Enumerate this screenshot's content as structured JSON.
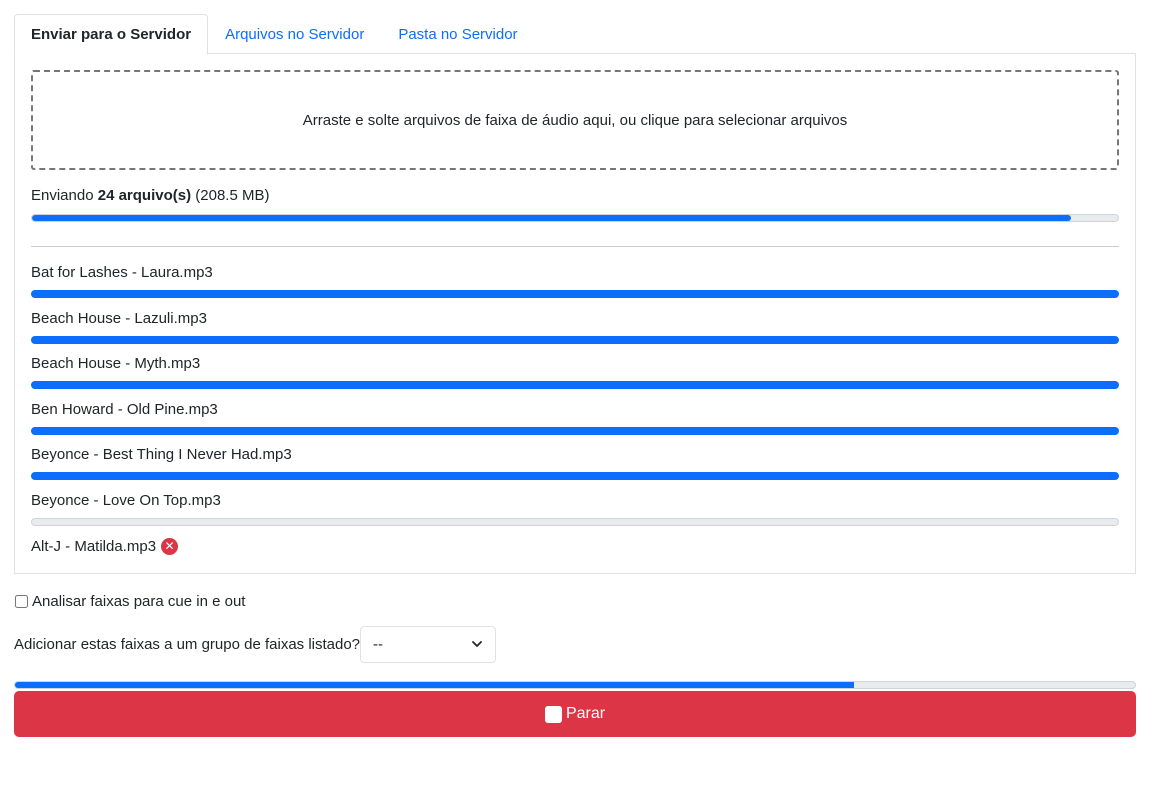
{
  "tabs": [
    {
      "label": "Enviar para o Servidor",
      "active": true
    },
    {
      "label": "Arquivos no Servidor",
      "active": false
    },
    {
      "label": "Pasta no Servidor",
      "active": false
    }
  ],
  "dropzone": {
    "text": "Arraste e solte arquivos de faixa de áudio aqui, ou clique para selecionar arquivos"
  },
  "upload": {
    "prefix": "Enviando",
    "count": "24 arquivo(s)",
    "size": "(208.5 MB)",
    "progress_pct": 95.7
  },
  "files": [
    {
      "name": "Bat for Lashes - Laura.mp3",
      "status": "done",
      "progress_pct": 100
    },
    {
      "name": "Beach House - Lazuli.mp3",
      "status": "done",
      "progress_pct": 100
    },
    {
      "name": "Beach House - Myth.mp3",
      "status": "done",
      "progress_pct": 100
    },
    {
      "name": "Ben Howard - Old Pine.mp3",
      "status": "done",
      "progress_pct": 100
    },
    {
      "name": "Beyonce - Best Thing I Never Had.mp3",
      "status": "done",
      "progress_pct": 100
    },
    {
      "name": "Beyonce - Love On Top.mp3",
      "status": "pending",
      "progress_pct": 0
    },
    {
      "name": "Alt-J - Matilda.mp3",
      "status": "error",
      "icon": "error-icon"
    }
  ],
  "form": {
    "analyze_label": "Analisar faixas para cue in e out",
    "analyze_checked": false,
    "group_label": "Adicionar estas faixas a um grupo de faixas listado?",
    "group_value": "--"
  },
  "total_progress_pct": 74.9,
  "stop_button": {
    "label": "Parar",
    "icon": "stop-icon"
  },
  "colors": {
    "primary": "#0d6efd",
    "danger": "#dc3545",
    "track": "#e9ecef"
  }
}
